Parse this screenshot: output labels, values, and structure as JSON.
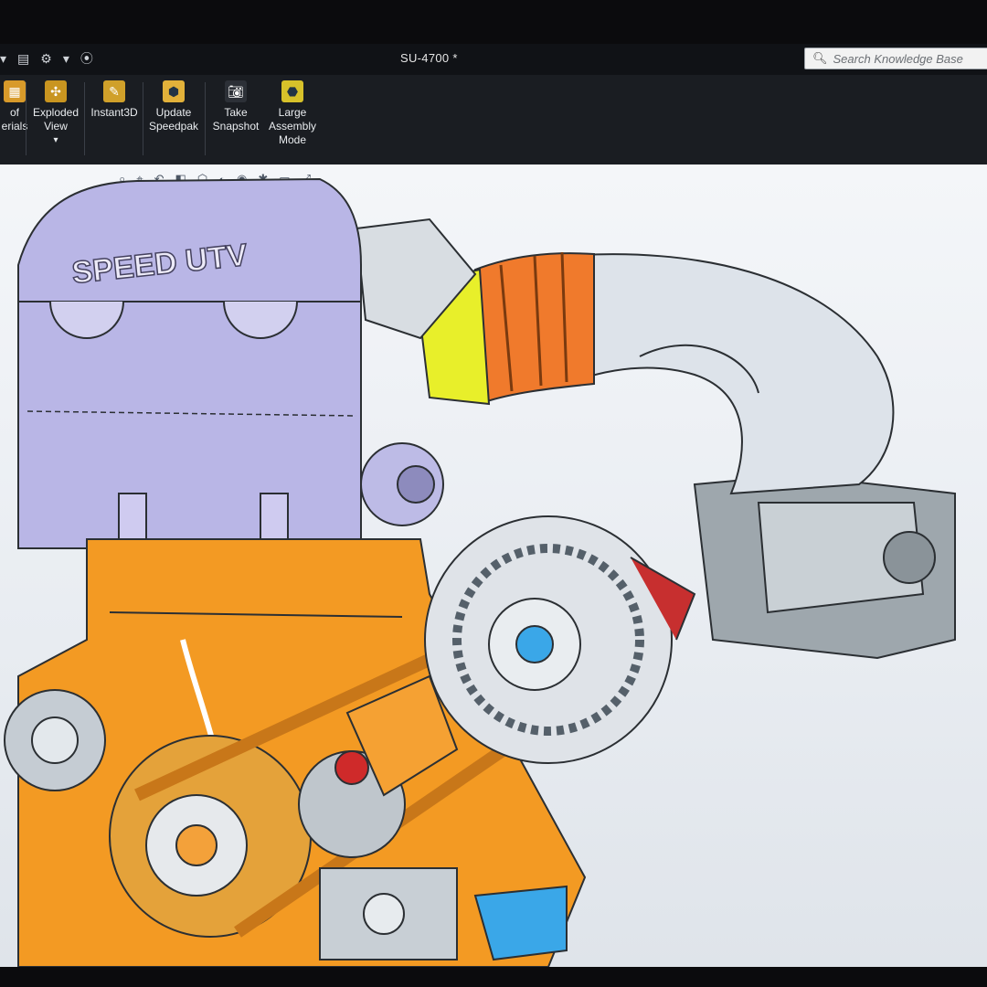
{
  "window": {
    "document_title": "SU-4700 *",
    "search_placeholder": "Search Knowledge Base"
  },
  "quick_access": [
    {
      "icon": "menu-icon",
      "glyph": "▾"
    },
    {
      "icon": "document-icon",
      "glyph": "▤"
    },
    {
      "icon": "gear-icon",
      "glyph": "⚙"
    },
    {
      "icon": "options-icon",
      "glyph": "▾"
    },
    {
      "icon": "traffic-light-icon",
      "glyph": "⦿"
    }
  ],
  "ribbon": {
    "bill_of_materials": "of\nerials",
    "exploded_view": "Exploded\nView",
    "instant3d": "Instant3D",
    "update_speedpak": "Update\nSpeedpak",
    "take_snapshot": "Take\nSnapshot",
    "large_assembly_mode": "Large\nAssembly\nMode"
  },
  "model": {
    "engine_logo": "SPEED UTV"
  },
  "colors": {
    "engine_block": "#f39a23",
    "valve_cover": "#b9b6e6",
    "intake_hose": "#f07a2c",
    "coupler": "#e8ef2a",
    "alternator": "#dfe3e8",
    "accent_blue": "#3aa7e8"
  }
}
